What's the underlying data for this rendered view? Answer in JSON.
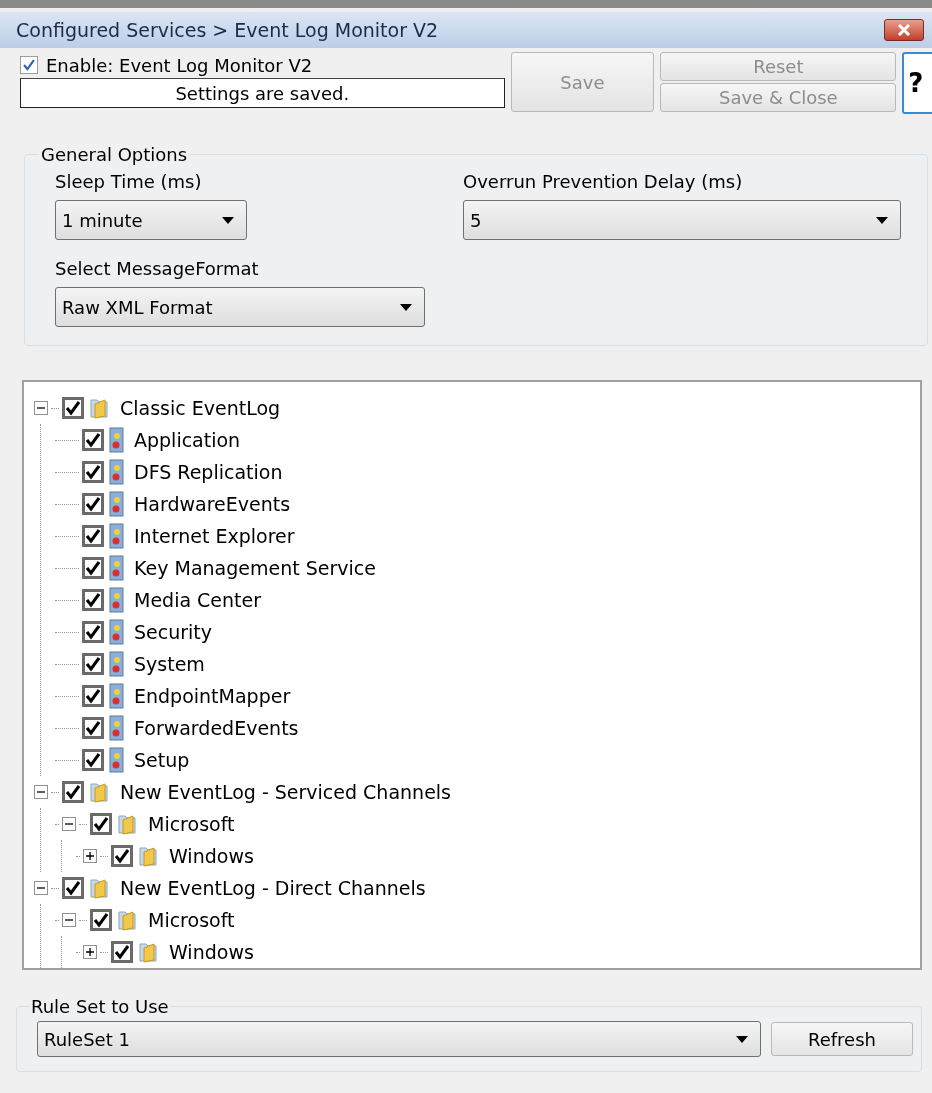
{
  "window": {
    "title": "Configured Services > Event Log Monitor V2"
  },
  "header": {
    "enable": {
      "label": "Enable: Event Log Monitor V2",
      "checked": true
    },
    "status": "Settings are saved.",
    "buttons": [
      {
        "kind": "save",
        "label": "Save",
        "disabled": true
      },
      {
        "kind": "reset",
        "label": "Reset",
        "disabled": true
      },
      {
        "kind": "saveclose",
        "label": "Save & Close",
        "disabled": true
      },
      {
        "kind": "help",
        "label": "?",
        "disabled": false
      }
    ]
  },
  "general_options": {
    "title": "General Options",
    "fields": [
      {
        "label": "Sleep Time (ms)",
        "value": "1 minute"
      },
      {
        "label": "Overrun Prevention Delay (ms)",
        "value": "5"
      },
      {
        "label": "Select MessageFormat",
        "value": "Raw XML Format"
      }
    ]
  },
  "tree": [
    {
      "kind": "folder",
      "label": "Classic EventLog",
      "checked": true,
      "expanded": true,
      "children": [
        {
          "kind": "log",
          "label": "Application",
          "checked": true
        },
        {
          "kind": "log",
          "label": "DFS Replication",
          "checked": true
        },
        {
          "kind": "log",
          "label": "HardwareEvents",
          "checked": true
        },
        {
          "kind": "log",
          "label": "Internet Explorer",
          "checked": true
        },
        {
          "kind": "log",
          "label": "Key Management Service",
          "checked": true
        },
        {
          "kind": "log",
          "label": "Media Center",
          "checked": true
        },
        {
          "kind": "log",
          "label": "Security",
          "checked": true
        },
        {
          "kind": "log",
          "label": "System",
          "checked": true
        },
        {
          "kind": "log",
          "label": "EndpointMapper",
          "checked": true
        },
        {
          "kind": "log",
          "label": "ForwardedEvents",
          "checked": true
        },
        {
          "kind": "log",
          "label": "Setup",
          "checked": true
        }
      ]
    },
    {
      "kind": "folder",
      "label": "New EventLog - Serviced Channels",
      "checked": true,
      "expanded": true,
      "children": [
        {
          "kind": "folder",
          "label": "Microsoft",
          "checked": true,
          "expanded": true,
          "children": [
            {
              "kind": "folder",
              "label": "Windows",
              "checked": true,
              "expanded": false
            }
          ]
        }
      ]
    },
    {
      "kind": "folder",
      "label": "New EventLog - Direct Channels",
      "checked": true,
      "expanded": true,
      "children": [
        {
          "kind": "folder",
          "label": "Microsoft",
          "checked": true,
          "expanded": true,
          "children": [
            {
              "kind": "folder",
              "label": "Windows",
              "checked": true,
              "expanded": false
            }
          ]
        }
      ]
    }
  ],
  "rule_set": {
    "title": "Rule Set to Use",
    "value": "RuleSet 1",
    "button": "Refresh"
  }
}
